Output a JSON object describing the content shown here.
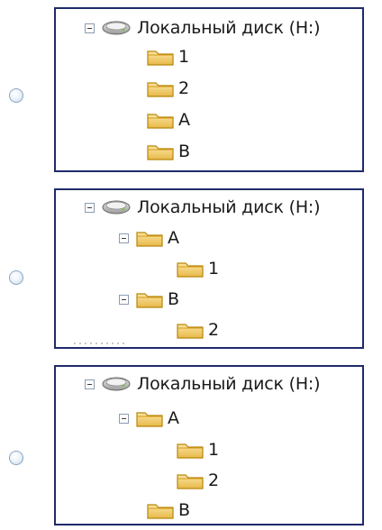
{
  "options": [
    {
      "tree": {
        "drive_label": "Локальный диск (H:)",
        "items": [
          {
            "label": "1"
          },
          {
            "label": "2"
          },
          {
            "label": "A"
          },
          {
            "label": "B"
          }
        ]
      }
    },
    {
      "tree": {
        "drive_label": "Локальный диск (H:)",
        "items": [
          {
            "label": "A"
          },
          {
            "label": "1"
          },
          {
            "label": "B"
          },
          {
            "label": "2"
          }
        ]
      }
    },
    {
      "tree": {
        "drive_label": "Локальный диск (H:)",
        "items": [
          {
            "label": "A"
          },
          {
            "label": "1"
          },
          {
            "label": "2"
          },
          {
            "label": "B"
          }
        ]
      }
    }
  ],
  "colors": {
    "panel_border": "#1f2a6b",
    "folder_fill": "#f3d27a",
    "folder_stroke": "#b8860b",
    "radio_border": "#8aa6c1"
  },
  "icons": {
    "drive": "hard-drive-icon",
    "folder": "folder-icon",
    "expander": "minus-box-icon"
  }
}
